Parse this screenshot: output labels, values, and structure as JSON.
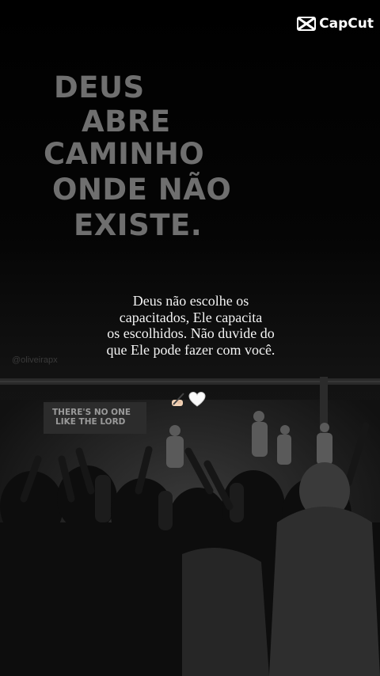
{
  "brand": {
    "name": "CapCut",
    "icon": "capcut-logo-icon"
  },
  "headline_lines": [
    "DEUS",
    "ABRE",
    "CAMINHO",
    "ONDE NÃO",
    "EXISTE."
  ],
  "watermark": "@oliveirapx",
  "quote_lines": [
    "Deus não escolhe os",
    "capacitados, Ele capacita",
    "os escolhidos. Não duvide do",
    "que Ele pode fazer com você."
  ],
  "emoji": [
    "writing-hand-icon",
    "white-heart-icon"
  ],
  "stage_banner": [
    "THERE'S NO ONE",
    "LIKE THE LORD"
  ],
  "colors": {
    "background": "#000000",
    "headline": "#6f6f6f",
    "quote": "#f4f4f4"
  }
}
